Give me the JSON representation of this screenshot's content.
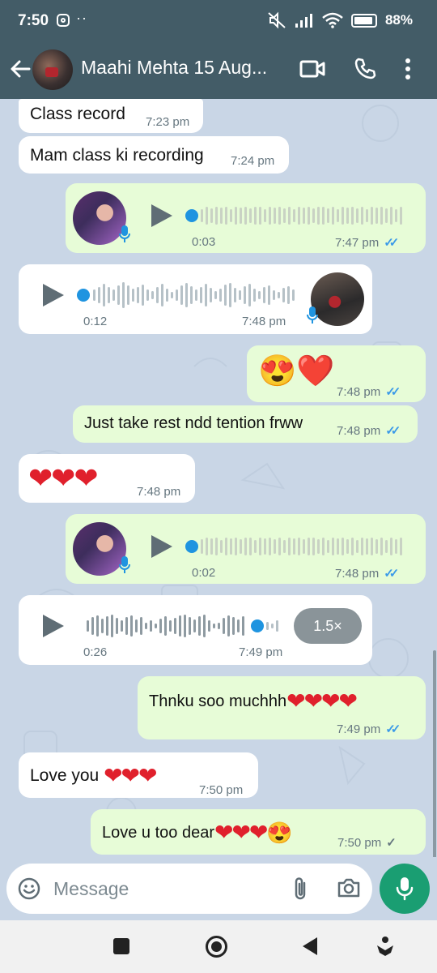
{
  "status_bar": {
    "time": "7:50",
    "dots": "··",
    "battery": "88%"
  },
  "header": {
    "contact_name": "Maahi Mehta 15 Aug..."
  },
  "messages": [
    {
      "type": "text",
      "dir": "in",
      "text": "Class record",
      "time": "7:23 pm"
    },
    {
      "type": "text",
      "dir": "in",
      "text": "Mam class ki recording",
      "time": "7:24 pm"
    },
    {
      "type": "voice",
      "dir": "out",
      "duration": "0:03",
      "time": "7:47 pm",
      "status": "read"
    },
    {
      "type": "voice",
      "dir": "in",
      "duration": "0:12",
      "time": "7:48 pm"
    },
    {
      "type": "emoji",
      "dir": "out",
      "text": "😍❤️",
      "time": "7:48 pm",
      "status": "read"
    },
    {
      "type": "text",
      "dir": "out",
      "text": "Just take rest ndd tention frww",
      "time": "7:48 pm",
      "status": "read"
    },
    {
      "type": "emoji",
      "dir": "in",
      "text": "❤❤❤",
      "time": "7:48 pm"
    },
    {
      "type": "voice",
      "dir": "out",
      "duration": "0:02",
      "time": "7:48 pm",
      "status": "read"
    },
    {
      "type": "voice",
      "dir": "in",
      "duration": "0:26",
      "time": "7:49 pm",
      "speed": "1.5×",
      "progress": 0.85
    },
    {
      "type": "text",
      "dir": "out",
      "text": "Thnku soo muchhh",
      "emoji": "❤❤❤❤",
      "time": "7:49 pm",
      "status": "read"
    },
    {
      "type": "text",
      "dir": "in",
      "text": "Love you ",
      "emoji": "❤❤❤",
      "time": "7:50 pm"
    },
    {
      "type": "text",
      "dir": "out",
      "text": "Love u too dear",
      "emoji": "❤❤❤",
      "emoji2": "😍",
      "time": "7:50 pm",
      "status": "sent"
    }
  ],
  "composer": {
    "placeholder": "Message"
  },
  "icons": {
    "back": "arrow-left-icon",
    "video": "video-call-icon",
    "call": "phone-icon",
    "menu": "more-vert-icon",
    "emoji": "emoji-icon",
    "attach": "paperclip-icon",
    "camera": "camera-icon",
    "mic": "microphone-icon"
  },
  "colors": {
    "header": "#435c67",
    "incoming": "#ffffff",
    "outgoing": "#e7fcd7",
    "accent": "#1a9e72",
    "read_ticks": "#3b9ae8",
    "wallpaper": "#c9d6e6"
  }
}
